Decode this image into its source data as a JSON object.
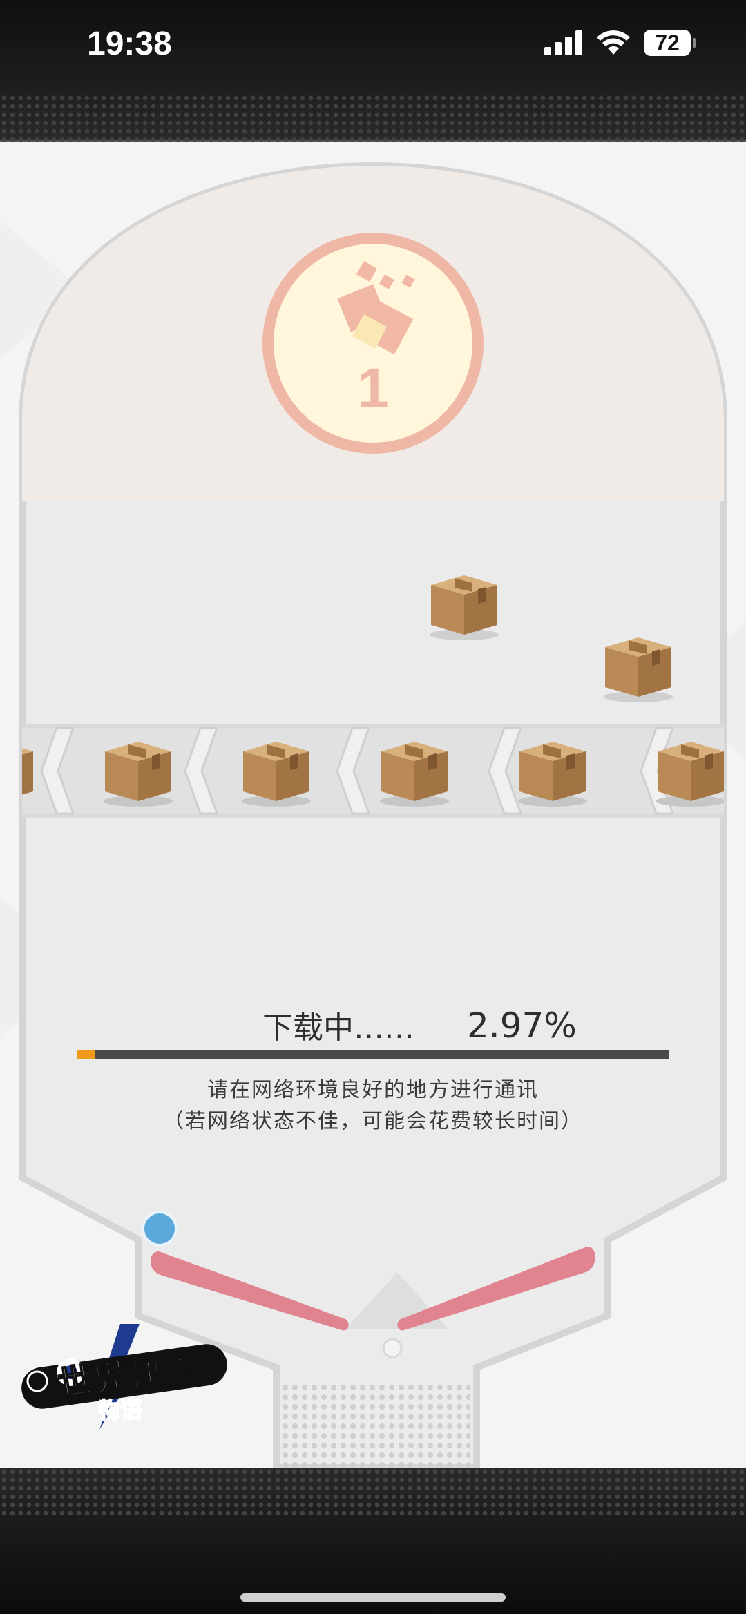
{
  "status_bar": {
    "time": "19:38",
    "battery": "72",
    "icons": [
      "signal-icon",
      "wifi-icon",
      "battery-icon"
    ]
  },
  "board": {
    "stage_number": "1",
    "conveyor_direction": "left"
  },
  "download": {
    "label": "下载中……",
    "percent": "2.97%",
    "progress": 0.0297,
    "notice_line1": "请在网络环境良好的地方进行通讯",
    "notice_line2": "（若网络状态不佳，可能会花费较长时间）"
  },
  "logo": {
    "text_main": "世界弹射",
    "text_sub": "物语"
  },
  "colors": {
    "progress_fill": "#f09a1c",
    "progress_track": "#4a4a4a",
    "flipper": "#e0848f",
    "ball": "#5aa8dc",
    "stage_badge": "#f0b4a0"
  }
}
